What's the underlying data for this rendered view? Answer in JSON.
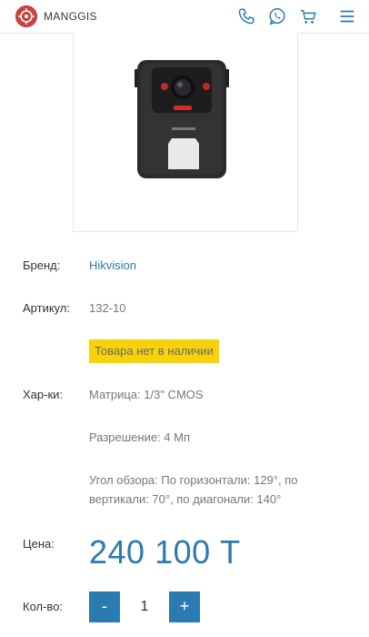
{
  "header": {
    "logo_text": "MANGGIS",
    "icons": [
      "phone-icon",
      "whatsapp-icon",
      "cart-icon",
      "menu-icon"
    ],
    "accent_color": "#2a7bb0",
    "logo_color": "#c8423f"
  },
  "product": {
    "brand_label": "Бренд:",
    "brand_value": "Hikvision",
    "sku_label": "Артикул:",
    "sku_value": "132-10",
    "availability": "Товара нет в наличии",
    "specs_label": "Хар-ки:",
    "specs": [
      "Матрица: 1/3\" CMOS",
      "Разрешение: 4 Мп",
      "Угол обзора: По горизонтали: 129°, по вертикали: 70°, по диагонали: 140°"
    ],
    "price_label": "Цена:",
    "price_value": "240 100 Т",
    "qty_label": "Кол-во:",
    "qty_minus": "-",
    "qty_value": "1",
    "qty_plus": "+"
  }
}
